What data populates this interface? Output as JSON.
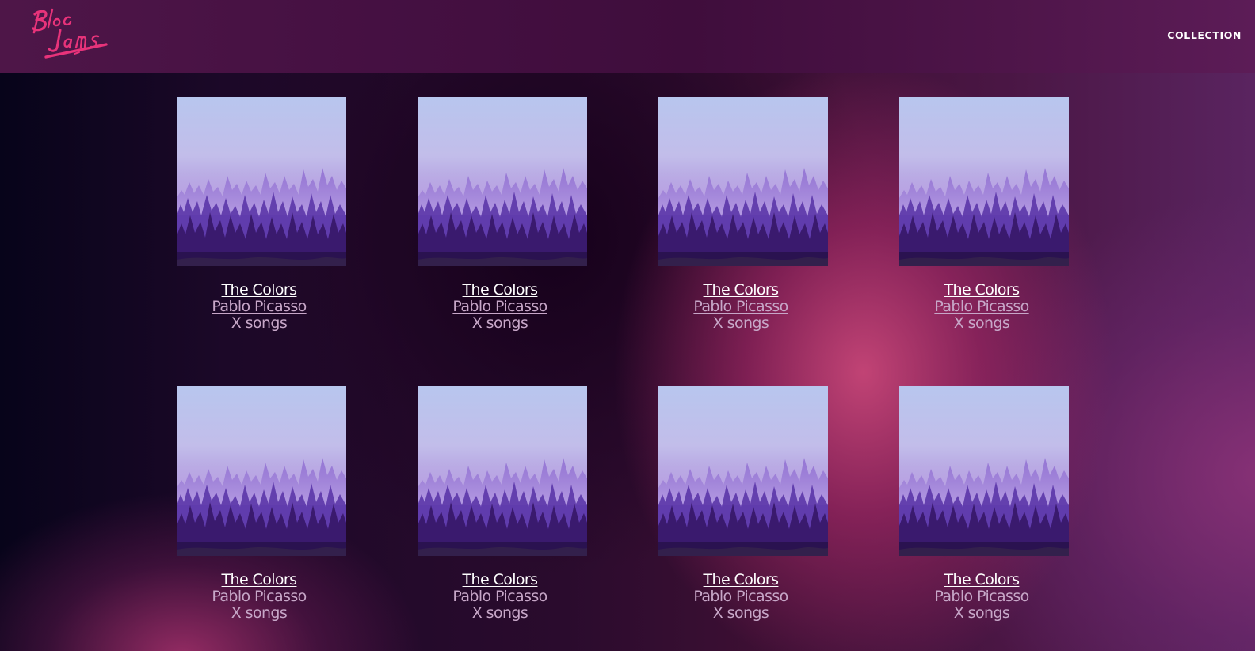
{
  "header": {
    "logo_text": "Bloc Jams",
    "nav": [
      {
        "label": "COLLECTION"
      }
    ]
  },
  "colors": {
    "header_bg": "#451042",
    "accent_logo": "#e8337a",
    "title_text": "#ffffff",
    "secondary_text": "#c7a7c8"
  },
  "albums": [
    {
      "title": "The Colors",
      "artist": "Pablo Picasso",
      "songs": "X songs",
      "cover_icon": "misty-forest-cover"
    },
    {
      "title": "The Colors",
      "artist": "Pablo Picasso",
      "songs": "X songs",
      "cover_icon": "misty-forest-cover"
    },
    {
      "title": "The Colors",
      "artist": "Pablo Picasso",
      "songs": "X songs",
      "cover_icon": "misty-forest-cover"
    },
    {
      "title": "The Colors",
      "artist": "Pablo Picasso",
      "songs": "X songs",
      "cover_icon": "misty-forest-cover"
    },
    {
      "title": "The Colors",
      "artist": "Pablo Picasso",
      "songs": "X songs",
      "cover_icon": "misty-forest-cover"
    },
    {
      "title": "The Colors",
      "artist": "Pablo Picasso",
      "songs": "X songs",
      "cover_icon": "misty-forest-cover"
    },
    {
      "title": "The Colors",
      "artist": "Pablo Picasso",
      "songs": "X songs",
      "cover_icon": "misty-forest-cover"
    },
    {
      "title": "The Colors",
      "artist": "Pablo Picasso",
      "songs": "X songs",
      "cover_icon": "misty-forest-cover"
    }
  ]
}
